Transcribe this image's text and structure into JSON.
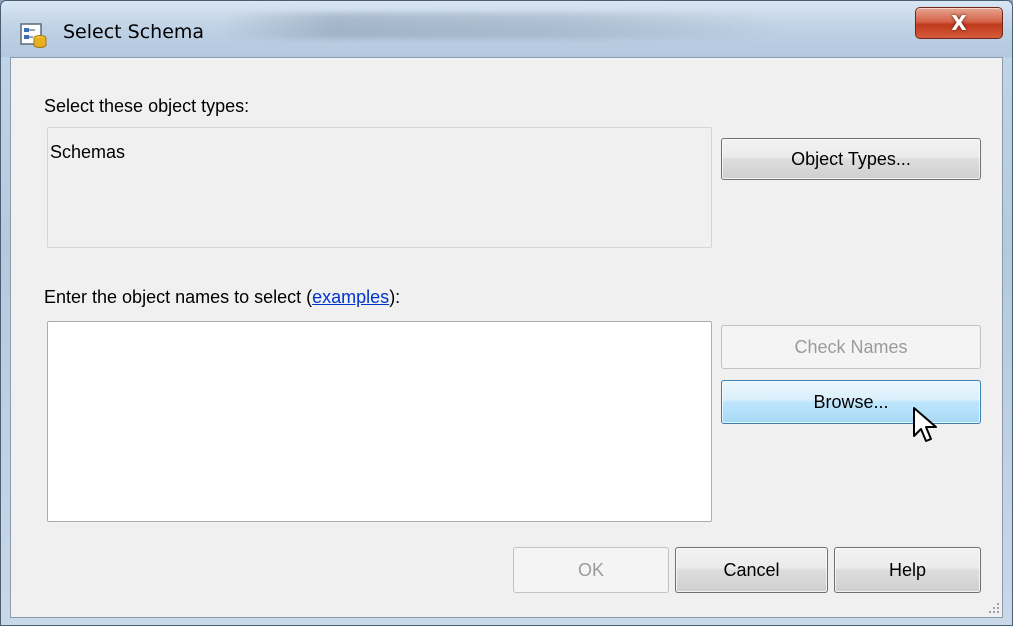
{
  "window": {
    "title": "Select Schema",
    "close_label": "X"
  },
  "object_types": {
    "label": "Select these object types:",
    "value": "Schemas",
    "button_label": "Object Types..."
  },
  "object_names": {
    "label_prefix": "Enter the object names to select (",
    "link_text": "examples",
    "label_suffix": "):",
    "value": ""
  },
  "buttons": {
    "check_names": "Check Names",
    "browse": "Browse...",
    "ok": "OK",
    "cancel": "Cancel",
    "help": "Help"
  },
  "colors": {
    "link": "#0033cc",
    "hover_button_border": "#3c7fb1",
    "close_button": "#c0391c"
  },
  "icons": [
    "schema-app-icon",
    "close-icon",
    "size-grip-icon",
    "mouse-pointer-icon"
  ]
}
